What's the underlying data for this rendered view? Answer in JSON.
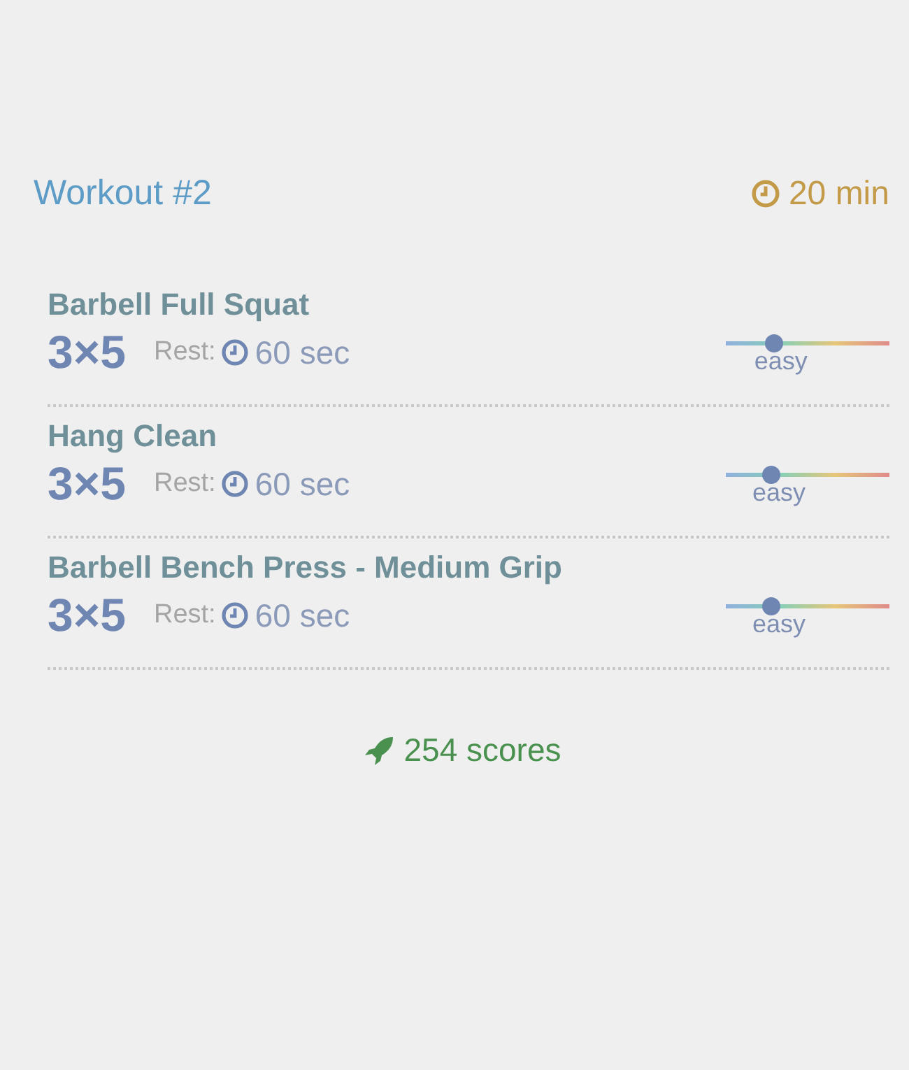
{
  "workout": {
    "title": "Workout #2",
    "duration": "20 min"
  },
  "exercises": [
    {
      "name": "Barbell Full Squat",
      "sets": "3×5",
      "rest_label": "Rest:",
      "rest": "60 sec",
      "level": 0.29,
      "difficulty": "easy"
    },
    {
      "name": "Hang Clean",
      "sets": "3×5",
      "rest_label": "Rest:",
      "rest": "60 sec",
      "level": 0.27,
      "difficulty": "easy"
    },
    {
      "name": "Barbell Bench Press - Medium Grip",
      "sets": "3×5",
      "rest_label": "Rest:",
      "rest": "60 sec",
      "level": 0.27,
      "difficulty": "easy"
    }
  ],
  "scores": "254 scores"
}
